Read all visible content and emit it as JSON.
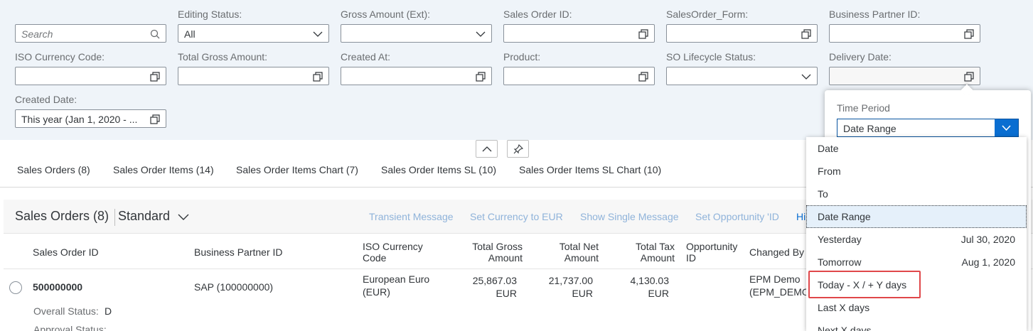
{
  "filters": {
    "search": {
      "placeholder": "Search"
    },
    "editing_status": {
      "label": "Editing Status:",
      "value": "All"
    },
    "gross_amount": {
      "label": "Gross Amount (Ext):",
      "value": ""
    },
    "sales_order_id": {
      "label": "Sales Order ID:",
      "value": ""
    },
    "salesorder_form": {
      "label": "SalesOrder_Form:",
      "value": ""
    },
    "business_partner_id": {
      "label": "Business Partner ID:",
      "value": ""
    },
    "iso_currency": {
      "label": "ISO Currency Code:",
      "value": ""
    },
    "total_gross": {
      "label": "Total Gross Amount:",
      "value": ""
    },
    "created_at": {
      "label": "Created At:",
      "value": ""
    },
    "product": {
      "label": "Product:",
      "value": ""
    },
    "so_lifecycle": {
      "label": "SO Lifecycle Status:",
      "value": ""
    },
    "delivery_date": {
      "label": "Delivery Date:",
      "value": ""
    },
    "created_date": {
      "label": "Created Date:",
      "value": "This year (Jan 1, 2020 - ..."
    }
  },
  "tabs": [
    "Sales Orders (8)",
    "Sales Order Items (14)",
    "Sales Order Items Chart (7)",
    "Sales Order Items SL (10)",
    "Sales Order Items SL Chart (10)"
  ],
  "panel": {
    "title": "Sales Orders (8)",
    "variant": "Standard",
    "toolbar": [
      "Transient Message",
      "Set Currency to EUR",
      "Show Single Message",
      "Set Opportunity 'ID",
      "Hi"
    ]
  },
  "table": {
    "columns": {
      "sales_order_id": "Sales Order ID",
      "business_partner_id": "Business Partner ID",
      "iso_currency_1": "ISO Currency",
      "iso_currency_2": "Code",
      "total_gross_1": "Total Gross",
      "total_gross_2": "Amount",
      "total_net_1": "Total Net",
      "total_net_2": "Amount",
      "total_tax_1": "Total Tax",
      "total_tax_2": "Amount",
      "opportunity_1": "Opportunity",
      "opportunity_2": "ID",
      "changed_by": "Changed By"
    },
    "row": {
      "sales_order_id": "500000000",
      "business_partner": "SAP (100000000)",
      "currency_1": "European Euro",
      "currency_2": "(EUR)",
      "gross_1": "25,867.03",
      "gross_2": "EUR",
      "net_1": "21,737.00",
      "net_2": "EUR",
      "tax_1": "4,130.03",
      "tax_2": "EUR",
      "changed_by_1": "EPM Demo",
      "changed_by_2": "(EPM_DEMO",
      "overall_status_label": "Overall Status:",
      "overall_status_value": "D",
      "approval_status_label": "Approval Status:"
    }
  },
  "popover": {
    "time_period_label": "Time Period",
    "selected_value": "Date Range",
    "options": [
      {
        "label": "Date",
        "extra": ""
      },
      {
        "label": "From",
        "extra": ""
      },
      {
        "label": "To",
        "extra": ""
      },
      {
        "label": "Date Range",
        "extra": ""
      },
      {
        "label": "Yesterday",
        "extra": "Jul 30, 2020"
      },
      {
        "label": "Tomorrow",
        "extra": "Aug 1, 2020"
      },
      {
        "label": "Today - X / + Y days",
        "extra": ""
      },
      {
        "label": "Last X days",
        "extra": ""
      },
      {
        "label": "Next X days",
        "extra": ""
      }
    ]
  },
  "colors": {
    "filterbar_bg": "#eff4f9",
    "accent": "#0a6ed1",
    "highlight": "#e0474a",
    "selected_option_bg": "#e5f0fa"
  }
}
